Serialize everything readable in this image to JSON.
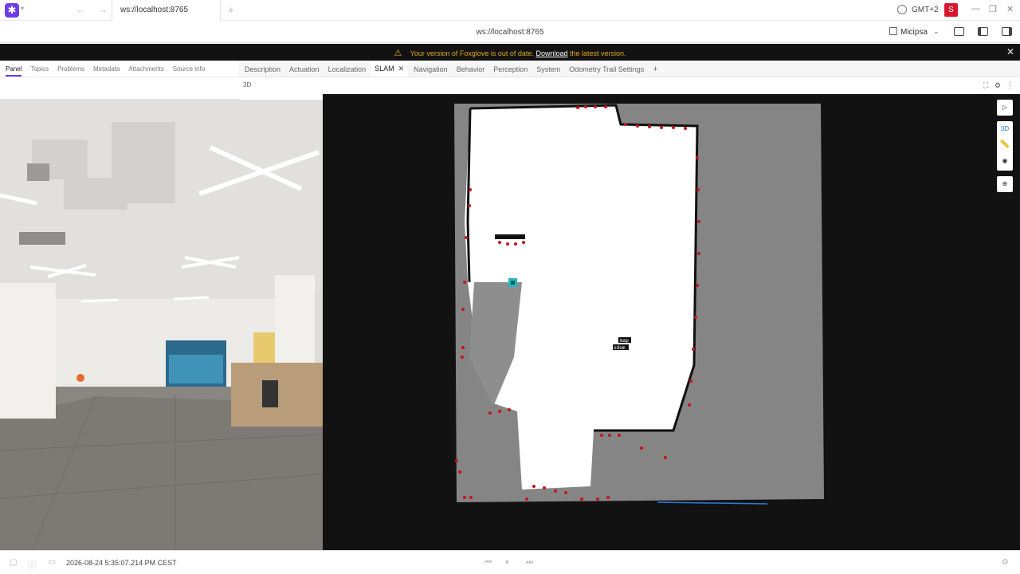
{
  "browser": {
    "tab_title": "ws://localhost:8765",
    "new_tab": "+",
    "timezone": "GMT+2",
    "user_initial": "S",
    "address": "ws://localhost:8765",
    "layout_name": "Micipsa"
  },
  "banner": {
    "before": "Your version of Foxglove is out of date.",
    "link": "Download",
    "after": "the latest version."
  },
  "sidebar": {
    "tabs": [
      "Panel",
      "Topics",
      "Problems",
      "Metadata",
      "Attachments",
      "Source info"
    ],
    "active": "Panel"
  },
  "layout_tabs": {
    "items": [
      "Description",
      "Actuation",
      "Localization",
      "SLAM",
      "Navigation",
      "Behavior",
      "Perception",
      "System",
      "Odometry Trail Settings"
    ],
    "active": "SLAM",
    "add": "+"
  },
  "panel": {
    "title": "3D",
    "view_mode": "3D"
  },
  "map": {
    "frame_labels": [
      "map",
      "odom"
    ]
  },
  "playback": {
    "timestamp": "2026-08-24 5:35:07.214 PM CEST"
  },
  "icons": {
    "app": "foxglove-logo-icon",
    "layout": "layout-icon",
    "warning": "warning-icon"
  },
  "colors": {
    "accent": "#6f3be8",
    "banner_text": "#e0a91b",
    "user_badge": "#d8172f",
    "laser_points": "#c8121c"
  }
}
